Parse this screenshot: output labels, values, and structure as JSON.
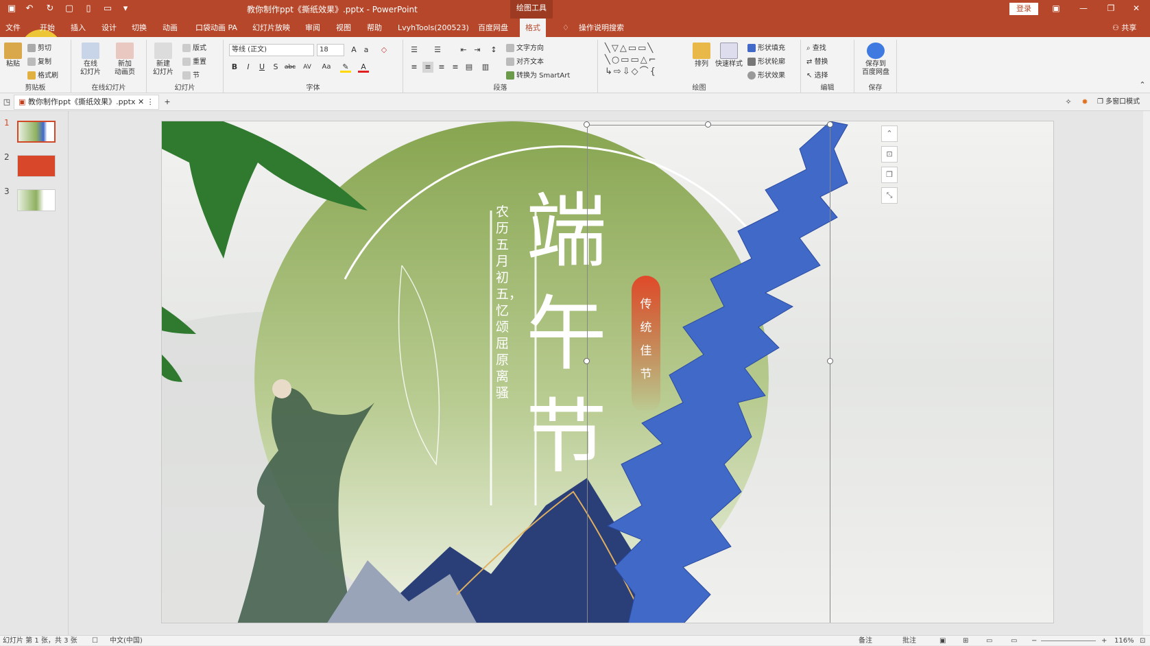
{
  "app": {
    "title": "教你制作ppt《撕纸效果》.pptx  -  PowerPoint",
    "context_tab_title": "绘图工具",
    "login_label": "登录",
    "share_label": "共享",
    "search_hint": "操作说明搜索"
  },
  "tabs": [
    "文件",
    "开始",
    "插入",
    "设计",
    "切换",
    "动画",
    "口袋动画 PA",
    "幻灯片放映",
    "审阅",
    "视图",
    "帮助",
    "LvyhTools(200523)",
    "百度网盘",
    "格式"
  ],
  "ribbon": {
    "clipboard": {
      "paste": "粘贴",
      "cut": "剪切",
      "copy": "复制",
      "format_painter": "格式刷",
      "label": "剪贴板"
    },
    "online_slides": {
      "online": "在线\n幻灯片",
      "new_anim": "新加\n动画页",
      "label": "在线幻灯片"
    },
    "slides": {
      "new": "新建\n幻灯片",
      "layout": "版式",
      "reset": "重置",
      "section": "节",
      "label": "幻灯片"
    },
    "font": {
      "name": "等线 (正文)",
      "size": "18",
      "label": "字体",
      "b": "B",
      "i": "I",
      "u": "U",
      "s": "S",
      "abc": "abc",
      "av": "AV",
      "aa": "Aa"
    },
    "paragraph": {
      "label": "段落"
    },
    "text": {
      "direction": "文字方向",
      "align": "对齐文本",
      "smartart": "转换为 SmartArt"
    },
    "drawing": {
      "arrange": "排列",
      "quick_styles": "快速样式",
      "fill": "形状填充",
      "outline": "形状轮廓",
      "effects": "形状效果",
      "label": "绘图"
    },
    "editing": {
      "find": "查找",
      "replace": "替换",
      "select": "选择",
      "label": "编辑"
    },
    "save": {
      "save_to": "保存到\n百度网盘",
      "label": "保存"
    }
  },
  "doc_tab": {
    "name": "教你制作ppt《撕纸效果》.pptx",
    "multiwindow": "多窗口模式"
  },
  "slides": [
    {
      "num": "1"
    },
    {
      "num": "2"
    },
    {
      "num": "3"
    }
  ],
  "slide": {
    "title_chars": [
      "端",
      "午",
      "节"
    ],
    "vertical_text": "农历五月初五，忆颂屈原离骚",
    "badge": [
      "传",
      "统",
      "佳",
      "节"
    ],
    "colors": {
      "green": "#7fa352",
      "blue": "#4169c8",
      "badge": "#e04a2a",
      "navy": "#1e3266"
    }
  },
  "status": {
    "left": "幻灯片 第 1 张，共 3 张",
    "lang": "中文(中国)",
    "notes": "备注",
    "comments": "批注",
    "zoom": "116%"
  }
}
